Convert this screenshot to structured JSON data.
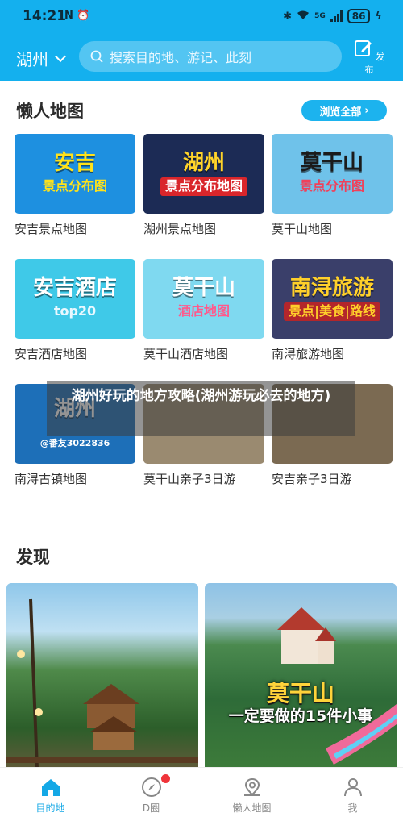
{
  "status": {
    "time": "14:21",
    "left_icons": "N ⏰",
    "network": "5G",
    "battery": "86"
  },
  "header": {
    "city": "湖州",
    "search_placeholder": "搜索目的地、游记、此刻",
    "publish_label": "发布"
  },
  "lazy_map": {
    "title": "懒人地图",
    "browse_all": "浏览全部",
    "cards": [
      {
        "label": "安吉景点地图",
        "line1": "安吉",
        "line2": "景点分布图",
        "bg": "#1e90e0",
        "c1": "#ffe21a",
        "c2": "#ffe21a",
        "b2": "transparent"
      },
      {
        "label": "湖州景点地图",
        "line1": "湖州",
        "line2": "景点分布地图",
        "bg": "#1c2b55",
        "c1": "#ffd42a",
        "c2": "#ffffff",
        "b2": "#d9262b"
      },
      {
        "label": "莫干山地图",
        "line1": "莫干山",
        "line2": "景点分布图",
        "bg": "#6fc2ea",
        "c1": "#1b1b1b",
        "c2": "#f0405a",
        "b2": "transparent"
      },
      {
        "label": "安吉酒店地图",
        "line1": "安吉酒店",
        "line2": "top20",
        "bg": "#3fc9e8",
        "c1": "#ffffff",
        "c2": "#e8f8ff",
        "b2": "transparent"
      },
      {
        "label": "莫干山酒店地图",
        "line1": "莫干山",
        "line2": "酒店地图",
        "bg": "#7fd9f0",
        "c1": "#ffffff",
        "c2": "#ff5a8c",
        "b2": "transparent"
      },
      {
        "label": "南浔旅游地图",
        "line1": "南浔旅游",
        "line2": "景点|美食|路线",
        "bg": "#3a3f6a",
        "c1": "#ffd02a",
        "c2": "#ffd02a",
        "b2": "#b3262b"
      },
      {
        "label": "南浔古镇地图",
        "line1": "湖州",
        "line2": "@番友3022836",
        "bg": "#1d6fb8",
        "c1": "#ffffff",
        "c2": "#ffffff",
        "b2": "transparent"
      },
      {
        "label": "莫干山亲子3日游",
        "line1": "",
        "line2": "",
        "bg": "#9a8a70",
        "c1": "#ffffff",
        "c2": "#ffffff",
        "b2": "transparent"
      },
      {
        "label": "安吉亲子3日游",
        "line1": "",
        "line2": "",
        "bg": "#7b6a52",
        "c1": "#ffffff",
        "c2": "#ffffff",
        "b2": "transparent"
      }
    ]
  },
  "overlay_title": "湖州好玩的地方攻略(湖州游玩必去的地方)",
  "discover": {
    "title": "发现",
    "right_card_title": "莫干山",
    "right_card_subtitle": "一定要做的15件小事"
  },
  "bottom_nav": [
    {
      "label": "目的地",
      "active": true
    },
    {
      "label": "D圈",
      "active": false
    },
    {
      "label": "懒人地图",
      "active": false
    },
    {
      "label": "我",
      "active": false
    }
  ],
  "colors": {
    "brand": "#14b0ee",
    "active": "#14a8e6",
    "badge": "#f0343a"
  }
}
